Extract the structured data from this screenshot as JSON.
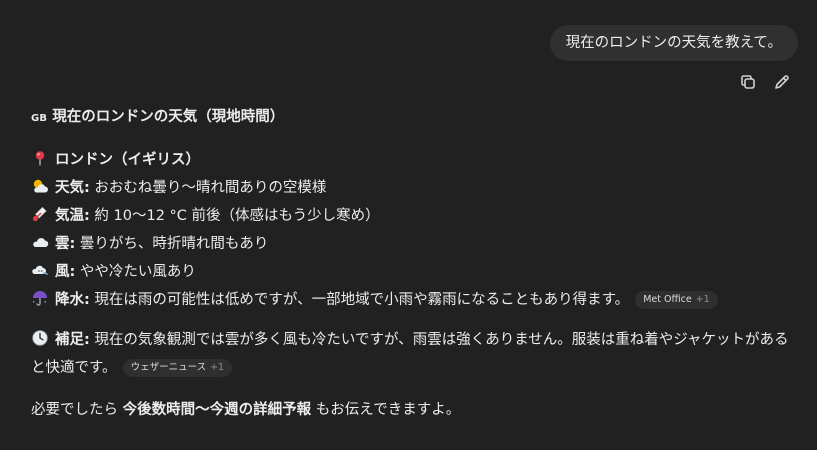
{
  "user": {
    "message": "現在のロンドンの天気を教えて。",
    "actions": [
      "copy-icon",
      "edit-icon"
    ]
  },
  "assistant": {
    "flag": "GB",
    "heading": "現在のロンドンの天気（現地時間）",
    "location": "ロンドン（イギリス）",
    "weather": {
      "label": "天気",
      "value": "おおむね曇り〜晴れ間ありの空模様"
    },
    "temperature": {
      "label": "気温",
      "value": "約 10〜12 °C 前後（体感はもう少し寒め）"
    },
    "clouds": {
      "label": "雲",
      "value": "曇りがち、時折晴れ間もあり"
    },
    "wind": {
      "label": "風",
      "value": "やや冷たい風あり"
    },
    "precip": {
      "label": "降水",
      "value": "現在は雨の可能性は低めですが、一部地域で小雨や霧雨になることもあり得ます。",
      "source": "Met Office",
      "source_count": "+1"
    },
    "note": {
      "label": "補足",
      "value": "現在の気象観測では雲が多く風も冷たいですが、雨雲は強くありません。服装は重ね着やジャケットがあると快適です。",
      "source": "ウェザーニュース",
      "source_count": "+1"
    },
    "closing": {
      "prefix": "必要でしたら",
      "bold": "今後数時間〜今週の詳細予報",
      "suffix": "もお伝えできますよ。"
    }
  },
  "colors": {
    "background": "#212121",
    "bubble": "#303030",
    "chip": "#2f2f2f",
    "text": "#ececec"
  }
}
